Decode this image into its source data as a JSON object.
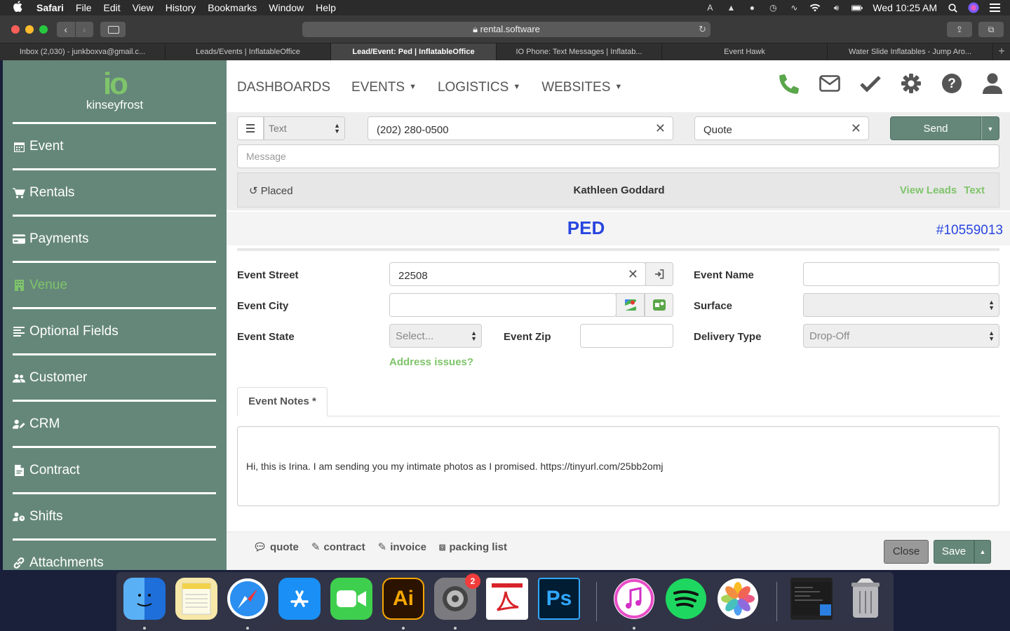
{
  "menubar": {
    "app": "Safari",
    "items": [
      "File",
      "Edit",
      "View",
      "History",
      "Bookmarks",
      "Window",
      "Help"
    ],
    "clock": "Wed 10:25 AM"
  },
  "browser": {
    "url": "rental.software",
    "tabs": [
      "Inbox (2,030) - junkboxva@gmail.c...",
      "Leads/Events | InflatableOffice",
      "Lead/Event: Ped | InflatableOffice",
      "IO Phone: Text Messages | Inflatab...",
      "Event Hawk",
      "Water Slide Inflatables - Jump Aro..."
    ],
    "active_tab": 2
  },
  "sidebar": {
    "logo_mark": "io",
    "org": "kinseyfrost",
    "items": [
      {
        "label": "Event",
        "icon": "calendar-icon"
      },
      {
        "label": "Rentals",
        "icon": "cart-icon"
      },
      {
        "label": "Payments",
        "icon": "credit-card-icon"
      },
      {
        "label": "Venue",
        "icon": "building-icon"
      },
      {
        "label": "Optional Fields",
        "icon": "list-icon"
      },
      {
        "label": "Customer",
        "icon": "users-icon"
      },
      {
        "label": "CRM",
        "icon": "user-edit-icon"
      },
      {
        "label": "Contract",
        "icon": "file-icon"
      },
      {
        "label": "Shifts",
        "icon": "user-clock-icon"
      },
      {
        "label": "Attachments",
        "icon": "link-icon"
      }
    ],
    "active": "Venue"
  },
  "topnav": {
    "items": [
      "DASHBOARDS",
      "EVENTS",
      "LOGISTICS",
      "WEBSITES"
    ]
  },
  "message_panel": {
    "type_value": "Text",
    "phone_value": "(202) 280-0500",
    "template_value": "Quote",
    "send_label": "Send",
    "message_placeholder": "Message",
    "status": "Placed",
    "customer_name": "Kathleen Goddard",
    "link_view_leads": "View Leads",
    "link_text": "Text"
  },
  "event": {
    "title": "PED",
    "number": "#10559013"
  },
  "form": {
    "street_label": "Event Street",
    "street_value": "22508",
    "city_label": "Event City",
    "city_value": "",
    "state_label": "Event State",
    "state_value": "Select...",
    "zip_label": "Event Zip",
    "zip_value": "",
    "name_label": "Event Name",
    "name_value": "",
    "surface_label": "Surface",
    "surface_value": "",
    "delivery_label": "Delivery Type",
    "delivery_value": "Drop-Off",
    "address_issues": "Address issues?"
  },
  "notes": {
    "tab_label": "Event Notes *",
    "content": "Hi, this is Irina. I am sending you my intimate photos as I promised. https://tinyurl.com/25bb2omj"
  },
  "footer": {
    "links": [
      "quote",
      "contract",
      "invoice",
      "packing list"
    ],
    "close_label": "Close",
    "save_label": "Save"
  },
  "dock": {
    "badge_count": "2"
  },
  "colors": {
    "sidebar": "#65877a",
    "accent_green": "#7fc46a",
    "title_blue": "#2845e0"
  }
}
